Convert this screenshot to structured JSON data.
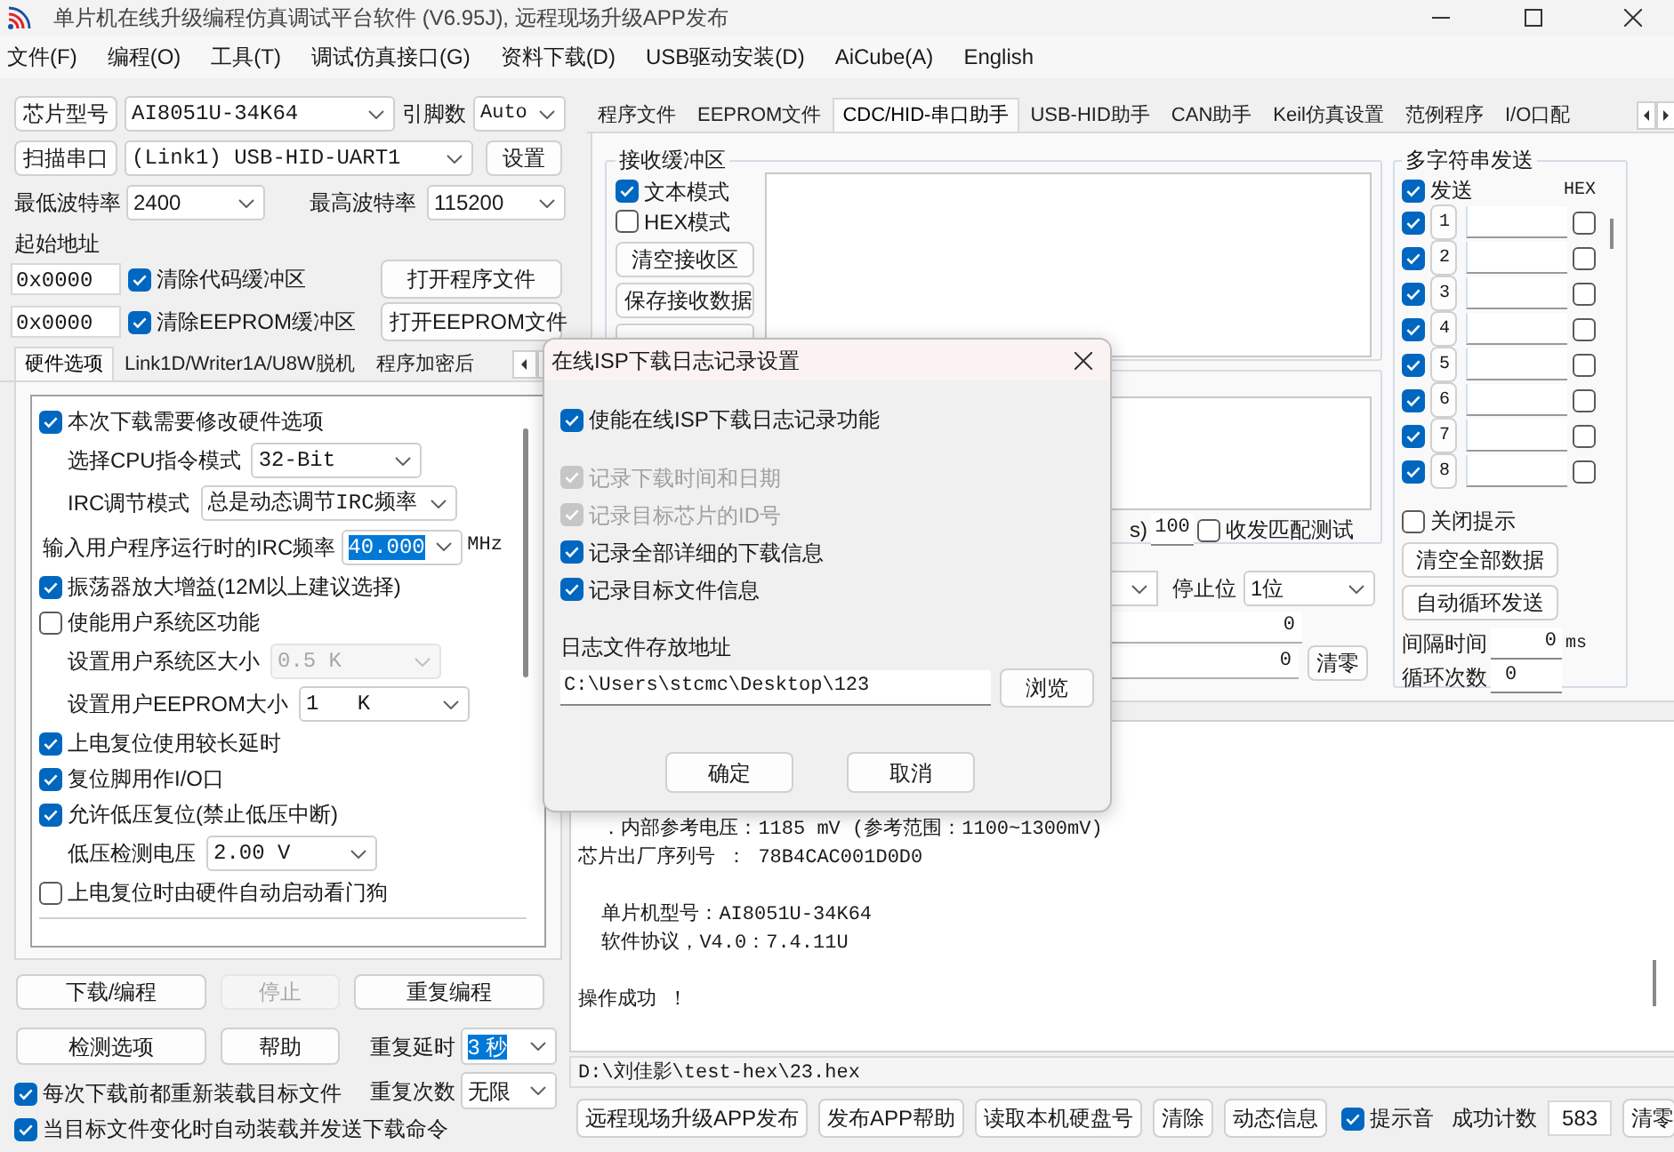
{
  "window": {
    "title": "单片机在线升级编程仿真调试平台软件 (V6.95J), 远程现场升级APP发布"
  },
  "menu": [
    "文件(F)",
    "编程(O)",
    "工具(T)",
    "调试仿真接口(G)",
    "资料下载(D)",
    "USB驱动安装(D)",
    "AiCube(A)",
    "English"
  ],
  "left_panel": {
    "chip_button": "芯片型号",
    "chip_value": "AI8051U-34K64",
    "pin_label": "引脚数",
    "pin_value": "Auto",
    "scan_button": "扫描串口",
    "port_value": "(Link1) USB-HID-UART1",
    "settings_button": "设置",
    "min_baud_label": "最低波特率",
    "min_baud_value": "2400",
    "max_baud_label": "最高波特率",
    "max_baud_value": "115200",
    "start_address_label": "起始地址",
    "address_rows": [
      {
        "value": "0x0000",
        "label": "清除代码缓冲区",
        "checked": true,
        "button": "打开程序文件"
      },
      {
        "value": "0x0000",
        "label": "清除EEPROM缓冲区",
        "checked": true,
        "button": "打开EEPROM文件"
      }
    ],
    "tabs": [
      {
        "label": "硬件选项",
        "selected": true
      },
      {
        "label": "Link1D/Writer1A/U8W脱机",
        "selected": false
      },
      {
        "label": "程序加密后",
        "selected": false
      }
    ],
    "options": [
      {
        "kind": "checkbox",
        "label": "本次下载需要修改硬件选项",
        "checked": true
      },
      {
        "kind": "select",
        "label": "选择CPU指令模式",
        "value": "32-Bit",
        "disabled": false
      },
      {
        "kind": "select",
        "label": "IRC调节模式",
        "value": "总是动态调节IRC频率",
        "disabled": false
      },
      {
        "kind": "frequency",
        "label": "输入用户程序运行时的IRC频率",
        "value": "40.000",
        "unit": "MHz",
        "highlighted": true
      },
      {
        "kind": "checkbox",
        "label": "振荡器放大增益(12M以上建议选择)",
        "checked": true
      },
      {
        "kind": "checkbox",
        "label": "使能用户系统区功能",
        "checked": false
      },
      {
        "kind": "select",
        "label": "设置用户系统区大小",
        "value": "0.5 K",
        "disabled": true
      },
      {
        "kind": "select",
        "label": "设置用户EEPROM大小",
        "value": "1   K",
        "disabled": false
      },
      {
        "kind": "checkbox",
        "label": "上电复位使用较长延时",
        "checked": true
      },
      {
        "kind": "checkbox",
        "label": "复位脚用作I/O口",
        "checked": true
      },
      {
        "kind": "checkbox",
        "label": "允许低压复位(禁止低压中断)",
        "checked": true
      },
      {
        "kind": "select",
        "label": "低压检测电压",
        "value": "2.00 V",
        "disabled": false
      },
      {
        "kind": "checkbox",
        "label": "上电复位时由硬件自动启动看门狗",
        "checked": false
      }
    ],
    "download_button": "下载/编程",
    "stop_button": {
      "label": "停止",
      "disabled": true
    },
    "repeat_button": "重复编程",
    "detect_button": "检测选项",
    "help_button": "帮助",
    "repeat_delay": {
      "label": "重复延时",
      "value": "3 秒",
      "highlighted": true
    },
    "repeat_count": {
      "label": "重复次数",
      "value": "无限",
      "highlighted": false
    },
    "reload_options": [
      {
        "label": "每次下载前都重新装载目标文件",
        "checked": true
      },
      {
        "label": "当目标文件变化时自动装载并发送下载命令",
        "checked": true
      }
    ]
  },
  "right_panel": {
    "tabs": [
      {
        "label": "程序文件",
        "selected": false
      },
      {
        "label": "EEPROM文件",
        "selected": false
      },
      {
        "label": "CDC/HID-串口助手",
        "selected": true
      },
      {
        "label": "USB-HID助手",
        "selected": false
      },
      {
        "label": "CAN助手",
        "selected": false
      },
      {
        "label": "Keil仿真设置",
        "selected": false
      },
      {
        "label": "范例程序",
        "selected": false
      },
      {
        "label": "I/O口配",
        "selected": false
      }
    ],
    "receive": {
      "title": "接收缓冲区",
      "modes": [
        {
          "label": "文本模式",
          "checked": true
        },
        {
          "label": "HEX模式",
          "checked": false
        }
      ],
      "buttons": [
        "清空接收区",
        "保存接收数据"
      ]
    },
    "send": {
      "interval_fragment": "s)",
      "interval_value": "100",
      "match_test": {
        "label": "收发匹配测试",
        "checked": false
      },
      "stop_bits_label": "停止位",
      "stop_bits_value": "1位",
      "counters": [
        "0",
        "0"
      ],
      "reset_button": "清零"
    },
    "multi_send": {
      "title": "多字符串发送",
      "send_all": {
        "label": "发送",
        "checked": true
      },
      "hex_header": "HEX",
      "rows": [
        {
          "number": "1",
          "checked": true,
          "hex": false
        },
        {
          "number": "2",
          "checked": true,
          "hex": false
        },
        {
          "number": "3",
          "checked": true,
          "hex": false
        },
        {
          "number": "4",
          "checked": true,
          "hex": false
        },
        {
          "number": "5",
          "checked": true,
          "hex": false
        },
        {
          "number": "6",
          "checked": true,
          "hex": false
        },
        {
          "number": "7",
          "checked": true,
          "hex": false
        },
        {
          "number": "8",
          "checked": true,
          "hex": false
        }
      ],
      "close_hint": {
        "label": "关闭提示",
        "checked": false
      },
      "buttons": [
        "清空全部数据",
        "自动循环发送"
      ],
      "interval": {
        "label": "间隔时间",
        "value": "0",
        "unit": "ms"
      },
      "loop_count": {
        "label": "循环次数",
        "value": "0"
      }
    }
  },
  "log": {
    "paragraphs": [
      [
        "  ．内部参考电压：1185 mV (参考范围：1100~1300mV)",
        "芯片出厂序列号 ： 78B4CAC001D0D0"
      ],
      [
        "  单片机型号：AI8051U-34K64",
        "  软件协议，V4.0：7.4.11U"
      ],
      [
        "操作成功 ！"
      ]
    ]
  },
  "file_path": "D:\\刘佳影\\test-hex\\23.hex",
  "bottom_bar": {
    "buttons": [
      "远程现场升级APP发布",
      "发布APP帮助",
      "读取本机硬盘号",
      "清除",
      "动态信息"
    ],
    "sound": {
      "label": "提示音",
      "checked": true
    },
    "count_label": "成功计数",
    "count_value": "583",
    "reset_button": "清零"
  },
  "dialog": {
    "title": "在线ISP下载日志记录设置",
    "enable": {
      "label": "使能在线ISP下载日志记录功能",
      "checked": true
    },
    "options": [
      {
        "label": "记录下载时间和日期",
        "checked": true,
        "disabled": true
      },
      {
        "label": "记录目标芯片的ID号",
        "checked": true,
        "disabled": true
      },
      {
        "label": "记录全部详细的下载信息",
        "checked": true,
        "disabled": false
      },
      {
        "label": "记录目标文件信息",
        "checked": true,
        "disabled": false
      }
    ],
    "path_label": "日志文件存放地址",
    "path_value": "C:\\Users\\stcmc\\Desktop\\123",
    "browse_button": "浏览",
    "ok_button": "确定",
    "cancel_button": "取消"
  }
}
